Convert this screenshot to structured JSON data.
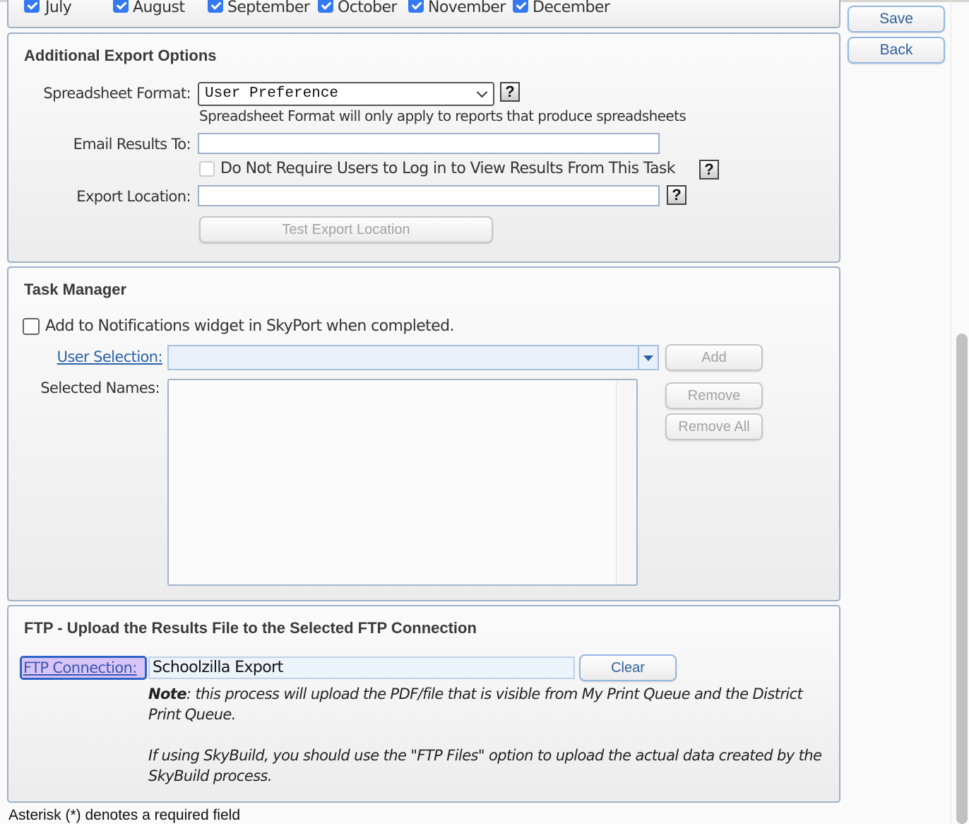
{
  "months": [
    {
      "label": "July",
      "checked": true
    },
    {
      "label": "August",
      "checked": true
    },
    {
      "label": "September",
      "checked": true
    },
    {
      "label": "October",
      "checked": true
    },
    {
      "label": "November",
      "checked": true
    },
    {
      "label": "December",
      "checked": true
    }
  ],
  "actions": {
    "save_label": "Save",
    "back_label": "Back"
  },
  "export_options": {
    "title": "Additional Export Options",
    "spreadsheet_format_label": "Spreadsheet Format:",
    "spreadsheet_format_value": "User Preference",
    "spreadsheet_format_hint": "Spreadsheet Format will only apply to reports that produce spreadsheets",
    "email_label": "Email Results To:",
    "email_value": "",
    "no_login_label": "Do Not Require Users to Log in to View Results From This Task",
    "no_login_checked": false,
    "export_location_label": "Export Location:",
    "export_location_value": "",
    "test_export_label": "Test Export Location",
    "help_glyph": "?"
  },
  "task_manager": {
    "title": "Task Manager",
    "notify_label": "Add to Notifications widget in SkyPort when completed.",
    "notify_checked": false,
    "user_selection_label": "User Selection:",
    "user_selection_value": "",
    "selected_names_label": "Selected Names:",
    "selected_names": [],
    "add_label": "Add",
    "remove_label": "Remove",
    "remove_all_label": "Remove All"
  },
  "ftp": {
    "title": "FTP - Upload the Results File to the Selected FTP Connection",
    "connection_label": "FTP Connection:",
    "connection_value": "Schoolzilla Export",
    "clear_label": "Clear",
    "note_bold": "Note",
    "note_text": ": this process will upload the PDF/file that is visible from My Print Queue and the District Print Queue.",
    "skybuild_text": "If using SkyBuild, you should use the \"FTP Files\" option to upload the actual data created by the SkyBuild process."
  },
  "footer": {
    "required_note": "Asterisk (*) denotes a required field"
  }
}
